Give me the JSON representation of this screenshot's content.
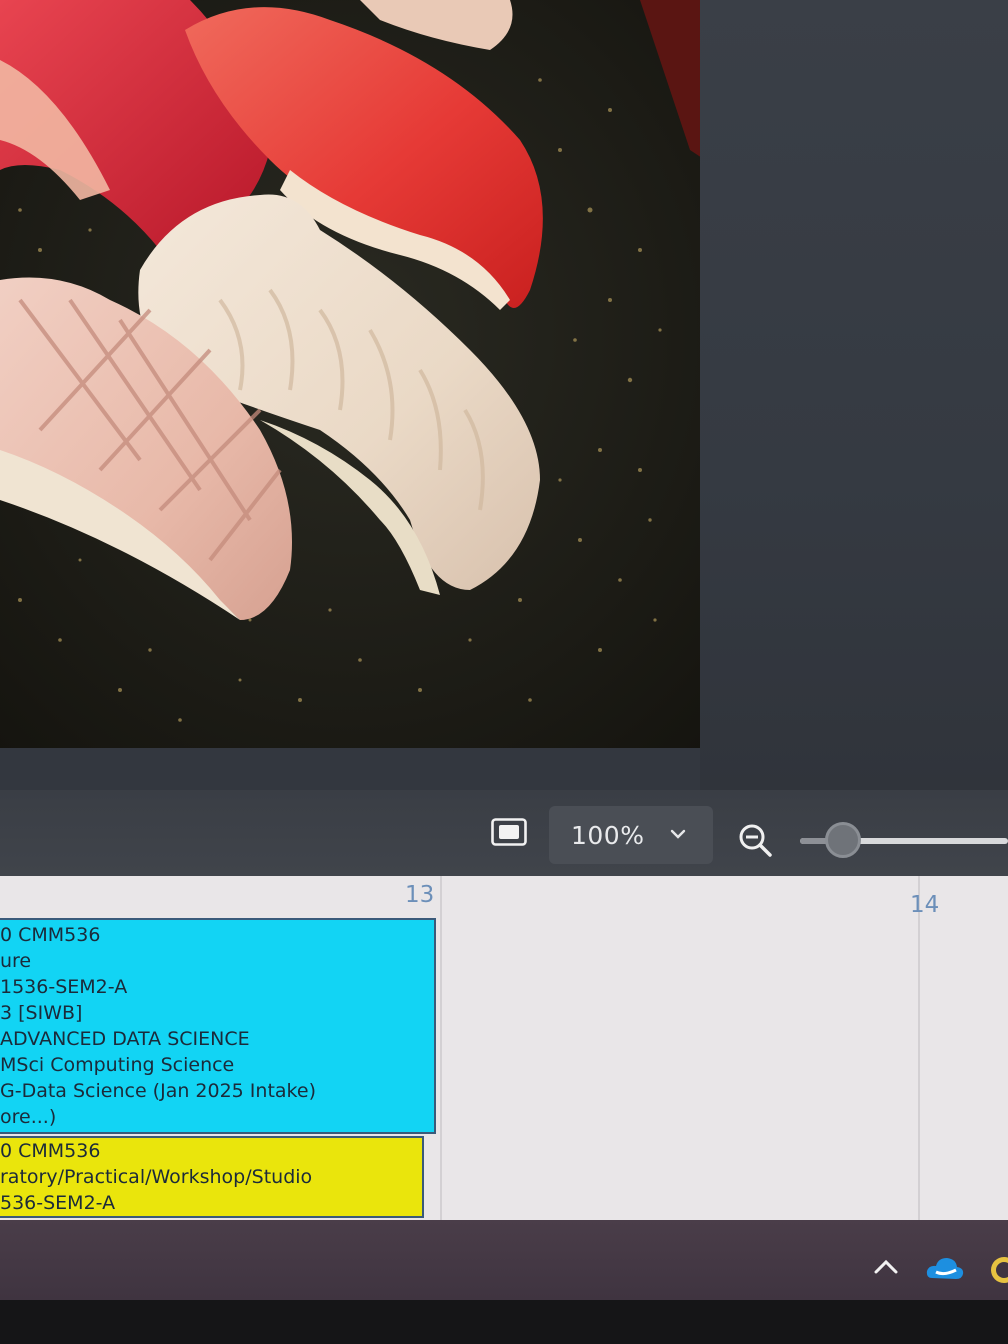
{
  "viewer": {
    "image_description_icon": "sushi-photo",
    "zoom": {
      "value": "100%",
      "caret_icon": "chevron-down-icon"
    },
    "fit_icon": "fit-to-window-icon",
    "zoom_out_icon": "zoom-out-icon",
    "slider_level_fraction": 0.2
  },
  "calendar": {
    "days": [
      {
        "number": "13"
      },
      {
        "number": "14"
      }
    ],
    "events": [
      {
        "color": "#12d4f4",
        "lines": [
          "0  CMM536",
          "ure",
          "1536-SEM2-A",
          "3 [SIWB]",
          "ADVANCED DATA SCIENCE",
          "MSci Computing Science",
          "G-Data Science (Jan 2025 Intake)",
          "ore...)"
        ]
      },
      {
        "color": "#eae50c",
        "lines": [
          "0  CMM536",
          "ratory/Practical/Workshop/Studio",
          "536-SEM2-A"
        ]
      }
    ]
  },
  "taskbar": {
    "tray_icons": [
      "chevron-up-icon",
      "onedrive-cloud-icon",
      "app-tray-icon"
    ]
  }
}
